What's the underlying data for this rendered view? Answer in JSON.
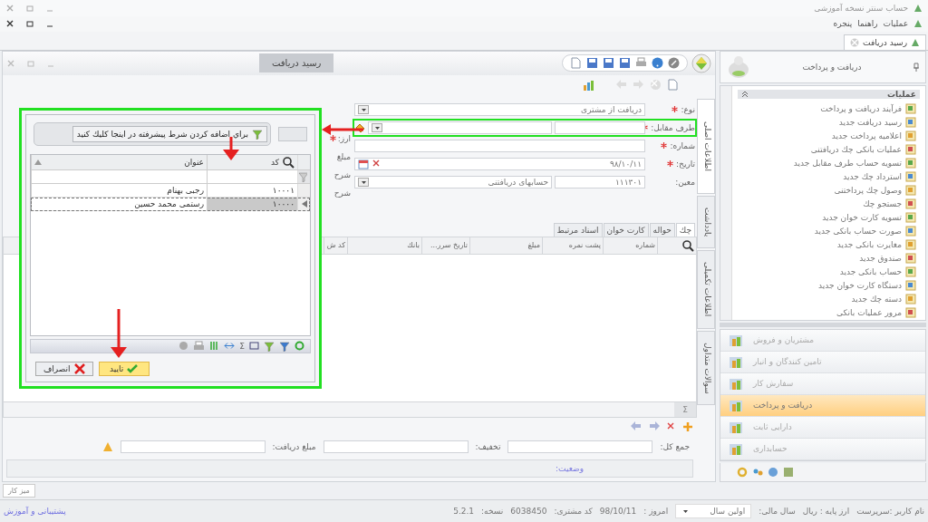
{
  "window": {
    "title": "حساب سنتر نسخه آموزشی"
  },
  "menu": [
    "عملیات",
    "راهنما",
    "پنجره"
  ],
  "doc_tabs": [
    {
      "label": "رسید دریافت",
      "selected": true
    }
  ],
  "document": {
    "title": "رسید دریافت",
    "side_tabs": [
      {
        "label": "اطلاعات اصلی",
        "selected": true
      },
      {
        "label": "یادداشت",
        "selected": false
      },
      {
        "label": "اطلاعات تکمیلی",
        "selected": false
      },
      {
        "label": "سوالات متداول",
        "selected": false
      }
    ],
    "fields": [
      {
        "label": "نوع:",
        "required": true,
        "kind": "dropdown",
        "value": "دریافت از مشتری",
        "highlighted": false
      },
      {
        "label": "طرف مقابل:",
        "required": true,
        "kind": "lookup",
        "highlighted": true
      },
      {
        "label": "شماره:",
        "required": true,
        "kind": "text",
        "highlighted": false
      },
      {
        "label": "تاریخ:",
        "required": true,
        "kind": "date",
        "value": "۹۸/۱۰/۱۱",
        "highlighted": false
      },
      {
        "label": "معین:",
        "required": false,
        "kind": "account",
        "code": "۱۱۱۳۰۱",
        "value": "حسابهای دریافتنی",
        "highlighted": false
      }
    ],
    "side_labels": [
      {
        "label": "ارز:",
        "required": true
      },
      {
        "label": "مبلغ",
        "required": false
      },
      {
        "label": "شرح",
        "required": false
      },
      {
        "label": "شرح",
        "required": false
      }
    ],
    "grid_tabs": [
      {
        "label": "چك",
        "selected": true
      },
      {
        "label": "حواله",
        "selected": false
      },
      {
        "label": "کارت خوان",
        "selected": false
      },
      {
        "label": "اسناد مرتبط",
        "selected": false
      }
    ],
    "grid_columns": [
      "شماره",
      "پشت نمره",
      "مبلغ",
      "تاریخ سرر...",
      "بانك",
      "کد ش"
    ],
    "sum_mark": "Σ",
    "totals": [
      "جمع کل:",
      "تخفیف:",
      "مبلغ دریافت:"
    ],
    "status_label": "وضعیت:"
  },
  "dialog": {
    "filter_hint": "براي اضافه كردن شرط پيشرفته در اينجا كليك كنيد",
    "columns": [
      "كد",
      "عنوان"
    ],
    "rows": [
      {
        "code": "۱۰۰۰۱",
        "title": "رجبی بهنام",
        "selected": false
      },
      {
        "code": "۱۰۰۰۰",
        "title": "رستمی محمد حسین",
        "selected": true
      }
    ],
    "sum_mark": "Σ",
    "buttons": [
      {
        "label": "تایید",
        "kind": "ok"
      },
      {
        "label": "انصراف",
        "kind": "cancel"
      }
    ]
  },
  "sidebar": {
    "title": "دریافت و پرداخت",
    "section": "عملیات",
    "items": [
      "فرآیند دریافت و پرداخت",
      "رسید دریافت جدید",
      "اعلامیه پرداخت جدید",
      "عملیات بانکی چك دریافتنی",
      "تسویه حساب طرف مقابل جدید",
      "استرداد چك جدید",
      "وصول چك پرداختنی",
      "جستجو چك",
      "تسویه کارت خوان جدید",
      "صورت حساب بانکی جدید",
      "مغایرت بانکی جدید",
      "صندوق جدید",
      "حساب بانکی جدید",
      "دستگاه کارت خوان جدید",
      "دسته چك جدید",
      "مرور عملیات بانکی"
    ],
    "modules": [
      {
        "label": "مشتریان و فروش",
        "selected": false
      },
      {
        "label": "تامین کنندگان و انبار",
        "selected": false
      },
      {
        "label": "سفارش کار",
        "selected": false
      },
      {
        "label": "دریافت و پرداخت",
        "selected": true
      },
      {
        "label": "دارایی ثابت",
        "selected": false
      },
      {
        "label": "حسابداری",
        "selected": false
      }
    ]
  },
  "desktop_button": "میز کار",
  "status_bar": {
    "user": "نام کاربر :سرپرست",
    "currency": "ارز پایه : ریال",
    "year_label": "سال مالی:",
    "year": "اولین سال",
    "today_label": "امروز :",
    "today": "98/10/11",
    "customer_label": "کد مشتری:",
    "customer": "6038450",
    "version_label": "نسخه:",
    "version": "5.2.1",
    "support_link": "پشتیبانی و آموزش"
  }
}
